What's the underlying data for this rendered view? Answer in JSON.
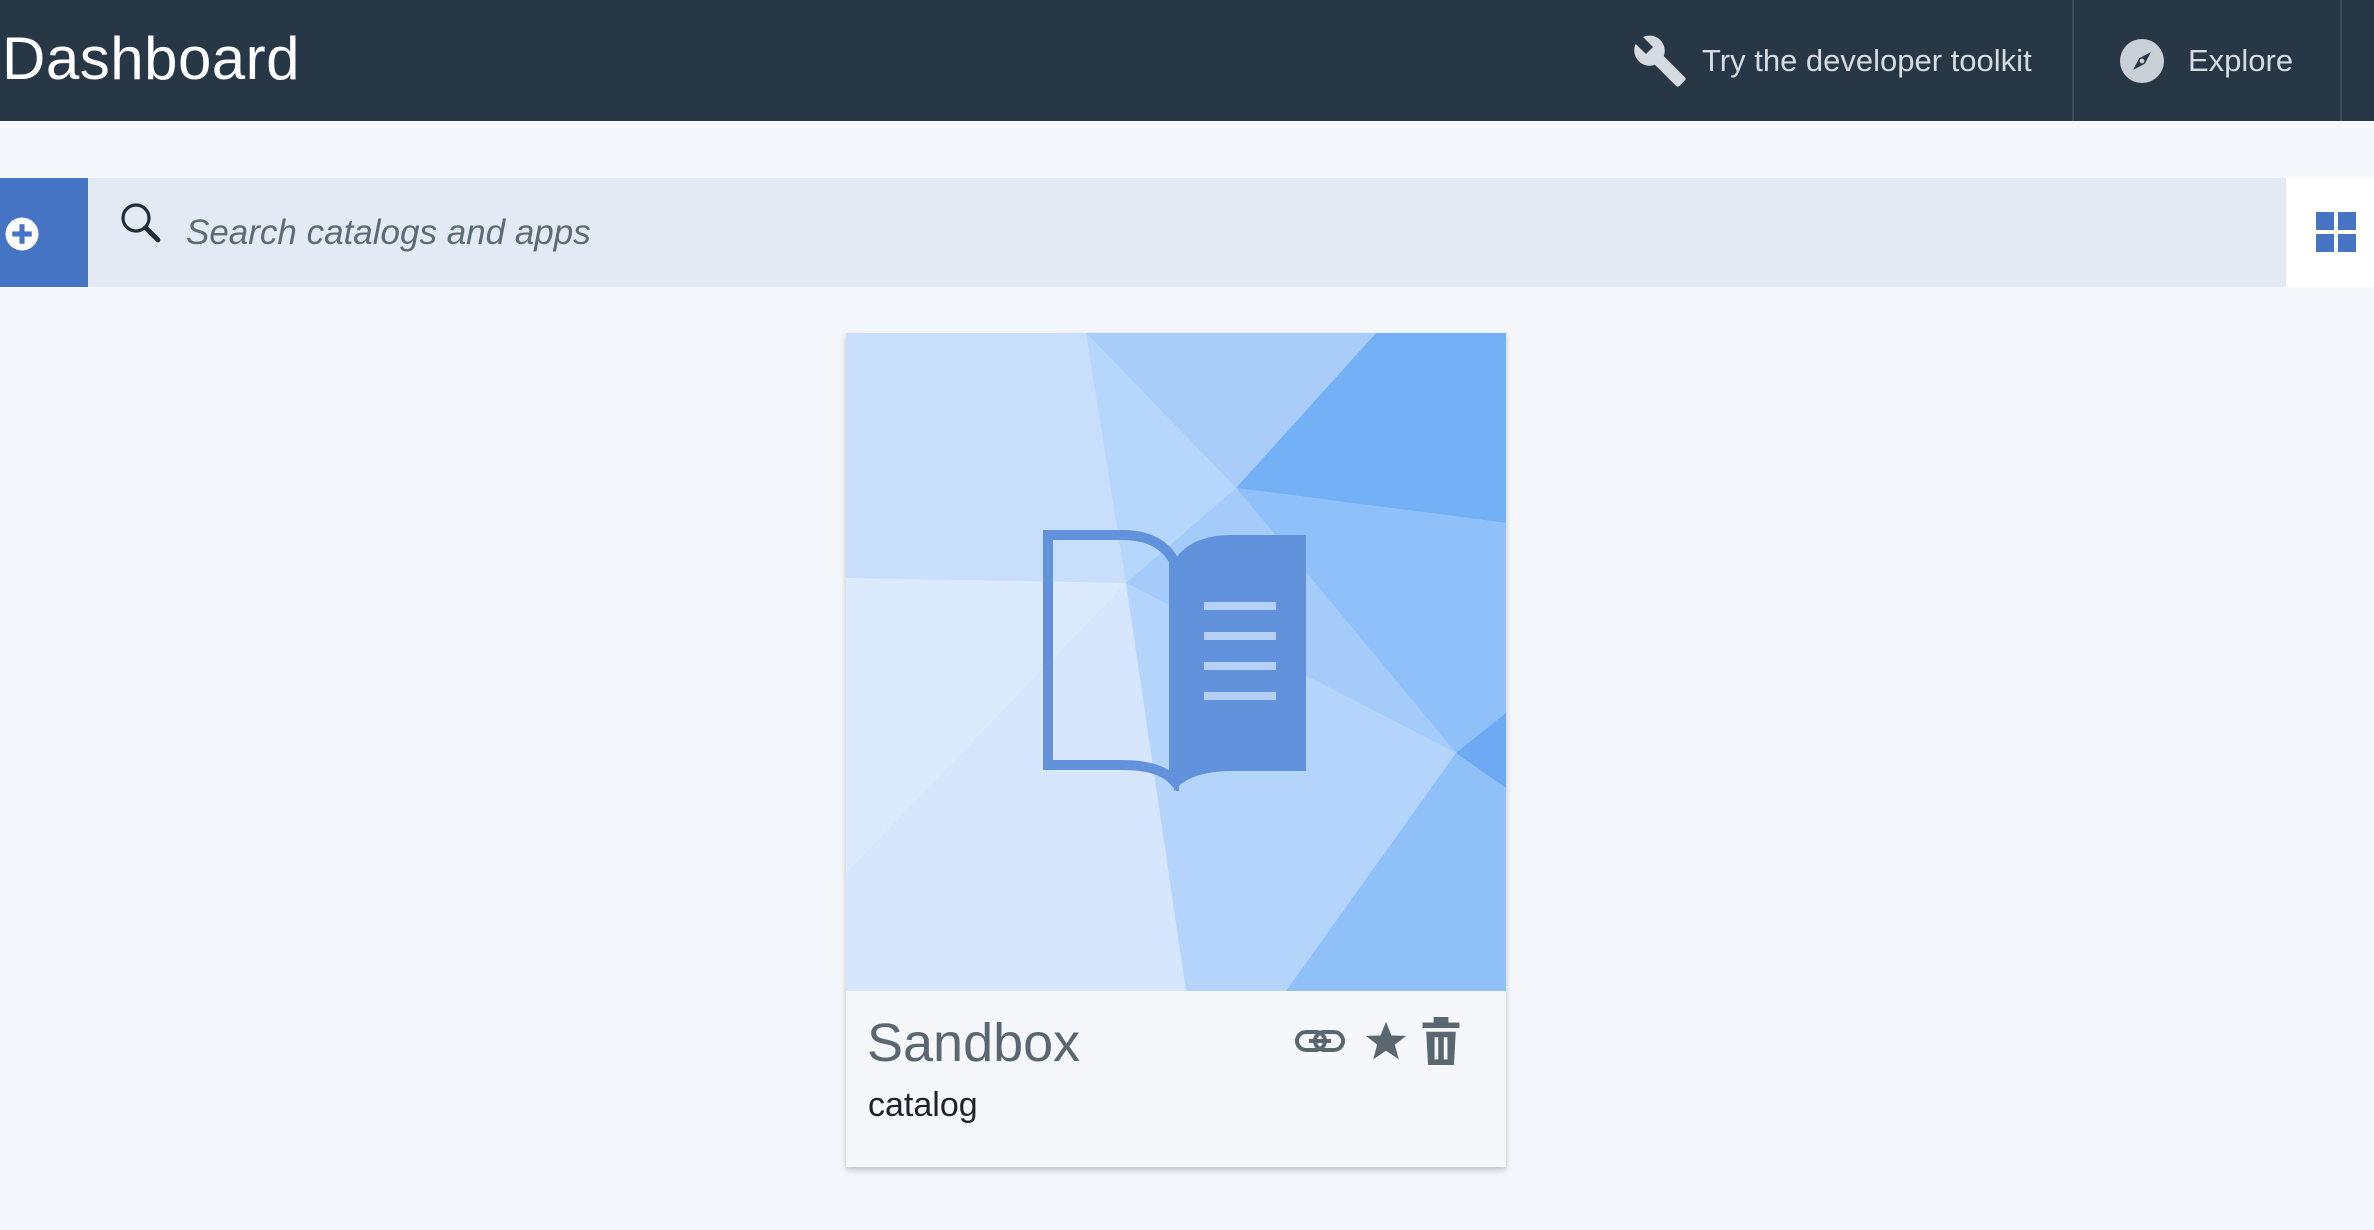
{
  "header": {
    "title": "Dashboard",
    "toolkit_label": "Try the developer toolkit",
    "toolkit_icon": "wrench-icon",
    "explore_label": "Explore",
    "explore_icon": "compass-icon",
    "background_color": "#283745"
  },
  "search": {
    "placeholder": "Search catalogs and apps",
    "value": "",
    "add_icon": "plus-circle-icon",
    "view_toggle_icon": "grid-view-icon"
  },
  "cards": [
    {
      "title": "Sandbox",
      "type": "catalog",
      "image_icon": "open-book-icon",
      "actions": [
        "link-icon",
        "star-icon",
        "trash-icon"
      ]
    }
  ],
  "colors": {
    "accent": "#4474c3",
    "page_background": "#f4f7fb",
    "search_background": "#e3eaf3"
  }
}
